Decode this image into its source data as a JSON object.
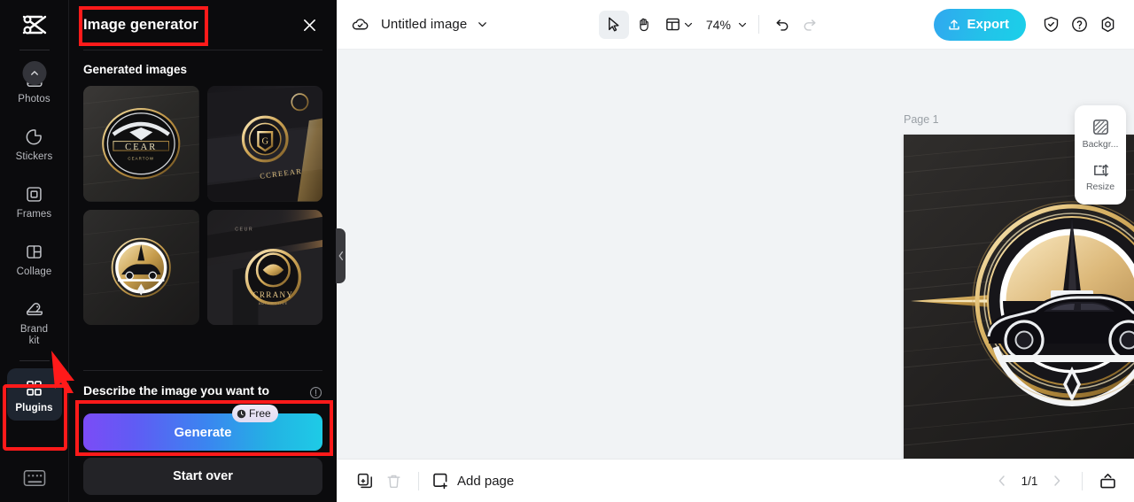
{
  "app": {
    "brand_icon": "capcut-logo-icon",
    "accent_cyan": "#1bcfe9",
    "accent_purple": "#7b4cf6",
    "annotation_color": "#ff1a1a"
  },
  "sidebar": {
    "items": [
      {
        "label": "Photos",
        "icon": "photos-icon",
        "badge": "chevron-up-icon",
        "active": false
      },
      {
        "label": "Stickers",
        "icon": "stickers-icon",
        "active": false
      },
      {
        "label": "Frames",
        "icon": "frames-icon",
        "active": false
      },
      {
        "label": "Collage",
        "icon": "collage-icon",
        "active": false
      },
      {
        "label": "Brand\nkit",
        "icon": "brand-kit-icon",
        "active": false
      },
      {
        "label": "Plugins",
        "icon": "plugins-icon",
        "active": true
      }
    ],
    "brand_kit_line1": "Brand",
    "brand_kit_line2": "kit",
    "keyboard_shortcut_icon": "keyboard-icon"
  },
  "panel": {
    "title": "Image generator",
    "close_icon": "close-icon",
    "generated_section_title": "Generated images",
    "thumbnails": [
      {
        "alt": "gold emblem car logo on dark wood",
        "style": "emblem-eagle"
      },
      {
        "alt": "gold circular badge on black card mockup",
        "style": "card-mockup"
      },
      {
        "alt": "gold and white circular car badge",
        "style": "circle-car"
      },
      {
        "alt": "gold round logo on black business card",
        "style": "round-gold"
      }
    ],
    "describe_label": "Describe the image you want to generate",
    "info_icon": "info-icon",
    "generate_label": "Generate",
    "free_badge_label": "Free",
    "free_badge_icon": "clock-icon",
    "start_over_label": "Start over",
    "collapse_icon": "chevron-left-icon"
  },
  "topbar": {
    "cloud_icon": "cloud-check-icon",
    "doc_title": "Untitled image",
    "title_caret_icon": "chevron-down-icon",
    "tools": [
      {
        "name": "select-tool",
        "icon": "cursor-icon",
        "active": true
      },
      {
        "name": "hand-tool",
        "icon": "hand-icon",
        "active": false
      },
      {
        "name": "frame-tool",
        "icon": "frame-icon",
        "active": false
      }
    ],
    "frame_caret_icon": "chevron-down-icon",
    "zoom_value": "74%",
    "zoom_caret_icon": "chevron-down-icon",
    "undo_icon": "undo-icon",
    "redo_icon": "redo-icon",
    "export_label": "Export",
    "export_icon": "upload-icon",
    "right_icons": [
      {
        "name": "shield-check-icon"
      },
      {
        "name": "help-circle-icon"
      },
      {
        "name": "settings-gear-icon"
      }
    ]
  },
  "canvas": {
    "page_label": "Page 1",
    "page_duplicate_icon": "duplicate-icon",
    "page_more_icon": "more-horizontal-icon",
    "artwork_alt": "Luxury car emblem logo: gold and white circle with black sports car silhouette on dark textured background"
  },
  "float_panel": {
    "items": [
      {
        "label": "Backgr...",
        "icon": "background-icon"
      },
      {
        "label": "Resize",
        "icon": "resize-icon"
      }
    ]
  },
  "bottombar": {
    "duplicate_page_icon": "duplicate-page-icon",
    "delete_page_icon": "trash-icon",
    "add_page_icon": "add-page-icon",
    "add_page_label": "Add page",
    "prev_icon": "chevron-left-icon",
    "page_indicator": "1/1",
    "next_icon": "chevron-right-icon",
    "present_icon": "present-icon"
  }
}
